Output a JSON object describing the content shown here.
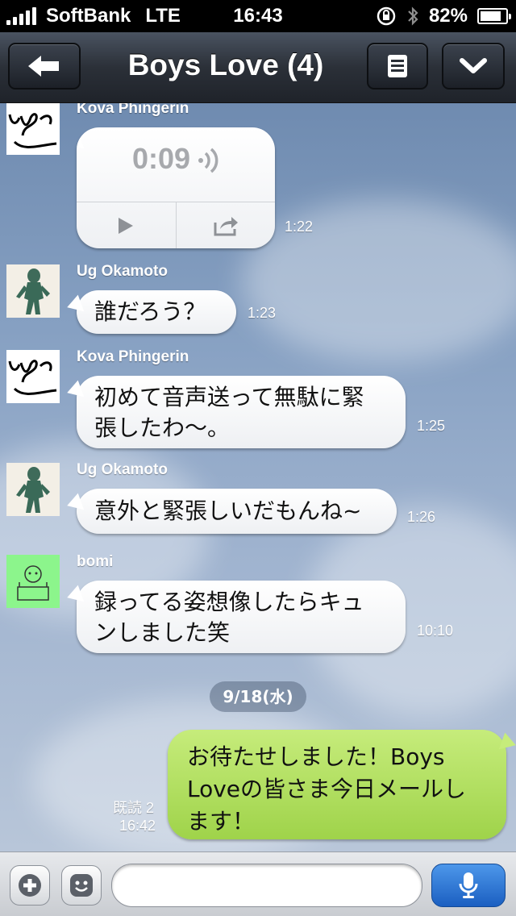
{
  "status": {
    "carrier": "SoftBank",
    "network": "LTE",
    "time": "16:43",
    "battery_text": "82%",
    "battery_level": 0.82
  },
  "nav": {
    "title": "Boys Love (4)",
    "back_icon": "back-arrow-icon",
    "menu_icon": "list-icon",
    "down_icon": "chevron-down-icon"
  },
  "messages": [
    {
      "sender": "Kova Phingerin",
      "type": "audio",
      "duration": "0:09",
      "time": "1:22"
    },
    {
      "sender": "Ug Okamoto",
      "text_lines": [
        "誰だろう？"
      ],
      "time": "1:23"
    },
    {
      "sender": "Kova Phingerin",
      "text_lines": [
        "初めて音声送って無駄に緊",
        "張したわ〜。"
      ],
      "time": "1:25"
    },
    {
      "sender": "Ug Okamoto",
      "text_lines": [
        "意外と緊張しいだもんね~"
      ],
      "time": "1:26"
    },
    {
      "sender": "bomi",
      "text_lines": [
        "録ってる姿想像したらキュ",
        "ンしました笑"
      ],
      "time": "10:10"
    }
  ],
  "date_separator": "9/18(水)",
  "my_message": {
    "text_lines": [
      "お待たせしました！Boys",
      "Loveの皆さま今日メールし",
      "ます！"
    ],
    "read_status": "既読 2",
    "time": "16:42"
  },
  "input": {
    "placeholder": "",
    "add_icon": "plus-icon",
    "sticker_icon": "smiley-icon",
    "mic_icon": "microphone-icon"
  }
}
